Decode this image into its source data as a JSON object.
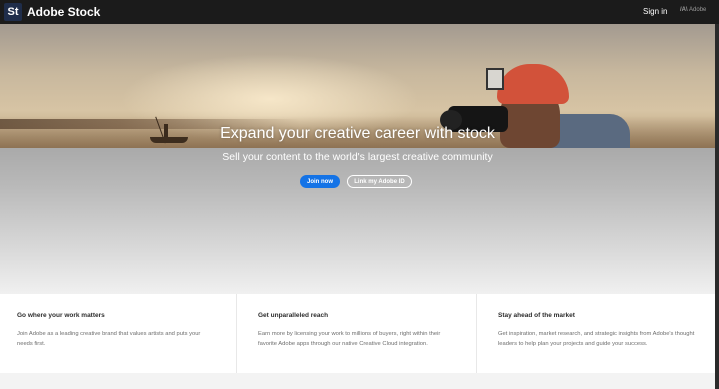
{
  "header": {
    "logo_text": "St",
    "brand": "Adobe Stock",
    "sign_in": "Sign in",
    "adobe_logo_text": "Adobe"
  },
  "hero": {
    "title": "Expand your creative career with stock",
    "subtitle": "Sell your content to the world's largest creative community",
    "join_button": "Join now",
    "link_button": "Link my Adobe ID"
  },
  "features": [
    {
      "title": "Go where your work matters",
      "text": "Join Adobe as a leading creative brand that values artists and puts your needs first."
    },
    {
      "title": "Get unparalleled reach",
      "text": "Earn more by licensing your work to millions of buyers, right within their favorite Adobe apps through our native Creative Cloud integration."
    },
    {
      "title": "Stay ahead of the market",
      "text": "Get inspiration, market research, and strategic insights from Adobe's thought leaders to help plan your projects and guide your success."
    }
  ],
  "colors": {
    "topbar": "#1b1b1b",
    "accent": "#1473e6",
    "logo_badge": "#1f2d4a"
  }
}
